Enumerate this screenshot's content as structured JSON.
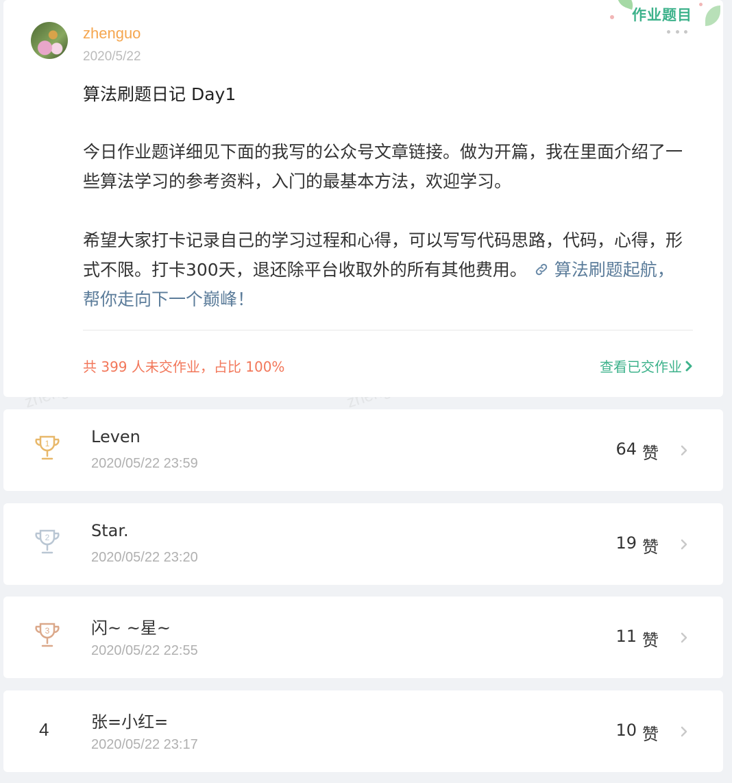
{
  "post": {
    "author": "zhenguo",
    "date": "2020/5/22",
    "badge": "作业题目",
    "title": "算法刷题日记 Day1",
    "para1": "今日作业题详细见下面的我写的公众号文章链接。做为开篇，我在里面介绍了一些算法学习的参考资料，入门的最基本方法，欢迎学习。",
    "para2_text": "希望大家打卡记录自己的学习过程和心得，可以写写代码思路，代码，心得，形式不限。打卡300天，退还除平台收取外的所有其他费用。",
    "para2_link": "算法刷题起航，帮你走向下一个巅峰！",
    "stat": "共 399 人未交作业，占比 100%",
    "view_link": "查看已交作业"
  },
  "watermark": "zhenguo 15452421841282",
  "submissions": [
    {
      "rank": "1",
      "name": "Leven",
      "time": "2020/05/22 23:59",
      "likes": "64",
      "likes_unit": "赞"
    },
    {
      "rank": "2",
      "name": "Star.",
      "time": "2020/05/22 23:20",
      "likes": "19",
      "likes_unit": "赞"
    },
    {
      "rank": "3",
      "name": "闪~ ~星~",
      "time": "2020/05/22 22:55",
      "likes": "11",
      "likes_unit": "赞"
    },
    {
      "rank": "4",
      "name": "张=小红=",
      "time": "2020/05/22 23:17",
      "likes": "10",
      "likes_unit": "赞"
    }
  ],
  "colors": {
    "gold": "#e8b86a",
    "silver": "#b9c6d3",
    "bronze": "#dba88a",
    "accent_green": "#3db28b",
    "stat_red": "#f2775a"
  }
}
